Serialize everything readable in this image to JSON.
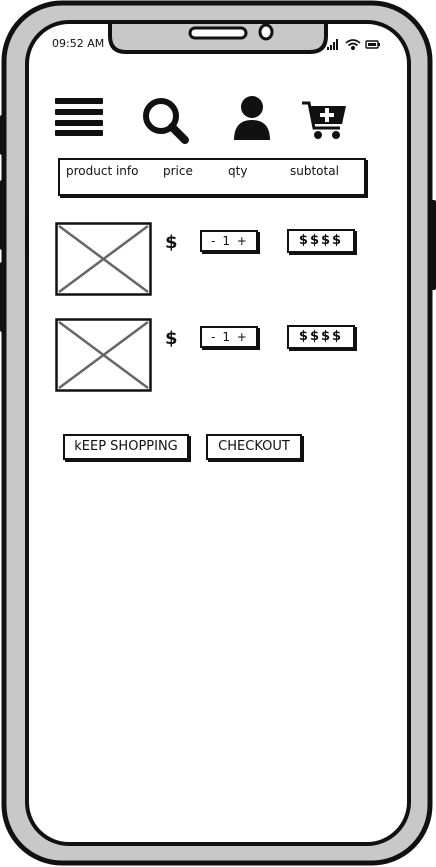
{
  "status_bar": {
    "time": "09:52 AM",
    "icons": [
      "signal-icon",
      "wifi-icon",
      "battery-icon"
    ]
  },
  "nav": {
    "icons": [
      "menu-icon",
      "search-icon",
      "user-icon",
      "cart-add-icon"
    ]
  },
  "table_header": {
    "product": "product info",
    "price": "price",
    "qty": "qty",
    "subtotal": "subtotal"
  },
  "cart_items": [
    {
      "price": "$",
      "qty": "- 1 +",
      "subtotal": "$$$$"
    },
    {
      "price": "$",
      "qty": "- 1 +",
      "subtotal": "$$$$"
    }
  ],
  "actions": {
    "keep_shopping": "kEEP SHOPPING",
    "checkout": "CHECKOUT"
  }
}
